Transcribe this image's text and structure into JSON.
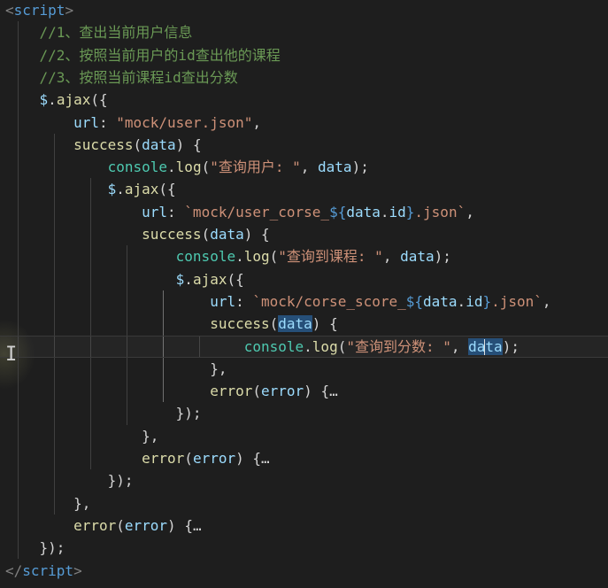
{
  "editor": {
    "lines": [
      {
        "segments": [
          {
            "t": "<",
            "c": "tag"
          },
          {
            "t": "script",
            "c": "kw"
          },
          {
            "t": ">",
            "c": "tag"
          }
        ]
      },
      {
        "segments": [
          {
            "t": "    //1、查出当前用户信息",
            "c": "cm"
          }
        ]
      },
      {
        "segments": [
          {
            "t": "    //2、按照当前用户的id查出他的课程",
            "c": "cm"
          }
        ]
      },
      {
        "segments": [
          {
            "t": "    //3、按照当前课程id查出分数",
            "c": "cm"
          }
        ]
      },
      {
        "segments": [
          {
            "t": "    ",
            "c": "pun"
          },
          {
            "t": "$",
            "c": "var"
          },
          {
            "t": ".",
            "c": "pun"
          },
          {
            "t": "ajax",
            "c": "fn"
          },
          {
            "t": "({",
            "c": "pun"
          }
        ]
      },
      {
        "segments": [
          {
            "t": "        ",
            "c": "pun"
          },
          {
            "t": "url",
            "c": "prop"
          },
          {
            "t": ": ",
            "c": "pun"
          },
          {
            "t": "\"mock/user.json\"",
            "c": "str"
          },
          {
            "t": ",",
            "c": "pun"
          }
        ]
      },
      {
        "segments": [
          {
            "t": "        ",
            "c": "pun"
          },
          {
            "t": "success",
            "c": "fn"
          },
          {
            "t": "(",
            "c": "pun"
          },
          {
            "t": "data",
            "c": "var"
          },
          {
            "t": ") {",
            "c": "pun"
          }
        ]
      },
      {
        "segments": [
          {
            "t": "            ",
            "c": "pun"
          },
          {
            "t": "console",
            "c": "cls"
          },
          {
            "t": ".",
            "c": "pun"
          },
          {
            "t": "log",
            "c": "fn"
          },
          {
            "t": "(",
            "c": "pun"
          },
          {
            "t": "\"查询用户: \"",
            "c": "str"
          },
          {
            "t": ", ",
            "c": "pun"
          },
          {
            "t": "data",
            "c": "var"
          },
          {
            "t": ");",
            "c": "pun"
          }
        ]
      },
      {
        "segments": [
          {
            "t": "            ",
            "c": "pun"
          },
          {
            "t": "$",
            "c": "var"
          },
          {
            "t": ".",
            "c": "pun"
          },
          {
            "t": "ajax",
            "c": "fn"
          },
          {
            "t": "({",
            "c": "pun"
          }
        ]
      },
      {
        "segments": [
          {
            "t": "                ",
            "c": "pun"
          },
          {
            "t": "url",
            "c": "prop"
          },
          {
            "t": ": ",
            "c": "pun"
          },
          {
            "t": "`mock/user_corse_",
            "c": "str"
          },
          {
            "t": "${",
            "c": "tpl"
          },
          {
            "t": "data",
            "c": "var"
          },
          {
            "t": ".",
            "c": "pun"
          },
          {
            "t": "id",
            "c": "prop"
          },
          {
            "t": "}",
            "c": "tpl"
          },
          {
            "t": ".json`",
            "c": "str"
          },
          {
            "t": ",",
            "c": "pun"
          }
        ]
      },
      {
        "segments": [
          {
            "t": "                ",
            "c": "pun"
          },
          {
            "t": "success",
            "c": "fn"
          },
          {
            "t": "(",
            "c": "pun"
          },
          {
            "t": "data",
            "c": "var"
          },
          {
            "t": ") {",
            "c": "pun"
          }
        ]
      },
      {
        "segments": [
          {
            "t": "                    ",
            "c": "pun"
          },
          {
            "t": "console",
            "c": "cls"
          },
          {
            "t": ".",
            "c": "pun"
          },
          {
            "t": "log",
            "c": "fn"
          },
          {
            "t": "(",
            "c": "pun"
          },
          {
            "t": "\"查询到课程: \"",
            "c": "str"
          },
          {
            "t": ", ",
            "c": "pun"
          },
          {
            "t": "data",
            "c": "var"
          },
          {
            "t": ");",
            "c": "pun"
          }
        ]
      },
      {
        "segments": [
          {
            "t": "                    ",
            "c": "pun"
          },
          {
            "t": "$",
            "c": "var"
          },
          {
            "t": ".",
            "c": "pun"
          },
          {
            "t": "ajax",
            "c": "fn"
          },
          {
            "t": "({",
            "c": "pun"
          }
        ]
      },
      {
        "segments": [
          {
            "t": "                        ",
            "c": "pun"
          },
          {
            "t": "url",
            "c": "prop"
          },
          {
            "t": ": ",
            "c": "pun"
          },
          {
            "t": "`mock/corse_score_",
            "c": "str"
          },
          {
            "t": "${",
            "c": "tpl"
          },
          {
            "t": "data",
            "c": "var"
          },
          {
            "t": ".",
            "c": "pun"
          },
          {
            "t": "id",
            "c": "prop"
          },
          {
            "t": "}",
            "c": "tpl"
          },
          {
            "t": ".json`",
            "c": "str"
          },
          {
            "t": ",",
            "c": "pun"
          }
        ]
      },
      {
        "segments": [
          {
            "t": "                        ",
            "c": "pun"
          },
          {
            "t": "success",
            "c": "fn"
          },
          {
            "t": "(",
            "c": "pun"
          },
          {
            "t": "data",
            "c": "var hl"
          },
          {
            "t": ") {",
            "c": "pun"
          }
        ]
      },
      {
        "current": true,
        "segments": [
          {
            "t": "                            ",
            "c": "pun"
          },
          {
            "t": "console",
            "c": "cls"
          },
          {
            "t": ".",
            "c": "pun"
          },
          {
            "t": "log",
            "c": "fn"
          },
          {
            "t": "(",
            "c": "pun"
          },
          {
            "t": "\"查询到分数: \"",
            "c": "str"
          },
          {
            "t": ", ",
            "c": "pun"
          },
          {
            "t": "da",
            "c": "var hl2"
          },
          {
            "caret": true
          },
          {
            "t": "ta",
            "c": "var hl2"
          },
          {
            "t": ");",
            "c": "pun"
          }
        ]
      },
      {
        "segments": [
          {
            "t": "                        },",
            "c": "pun"
          }
        ]
      },
      {
        "segments": [
          {
            "t": "                        ",
            "c": "pun"
          },
          {
            "t": "error",
            "c": "fn"
          },
          {
            "t": "(",
            "c": "pun"
          },
          {
            "t": "error",
            "c": "var"
          },
          {
            "t": ") {",
            "c": "pun"
          },
          {
            "t": "…",
            "c": "ell"
          }
        ]
      },
      {
        "segments": [
          {
            "t": "                    });",
            "c": "pun"
          }
        ]
      },
      {
        "segments": [
          {
            "t": "                },",
            "c": "pun"
          }
        ]
      },
      {
        "segments": [
          {
            "t": "                ",
            "c": "pun"
          },
          {
            "t": "error",
            "c": "fn"
          },
          {
            "t": "(",
            "c": "pun"
          },
          {
            "t": "error",
            "c": "var"
          },
          {
            "t": ") {",
            "c": "pun"
          },
          {
            "t": "…",
            "c": "ell"
          }
        ]
      },
      {
        "segments": [
          {
            "t": "            });",
            "c": "pun"
          }
        ]
      },
      {
        "segments": [
          {
            "t": "        },",
            "c": "pun"
          }
        ]
      },
      {
        "segments": [
          {
            "t": "        ",
            "c": "pun"
          },
          {
            "t": "error",
            "c": "fn"
          },
          {
            "t": "(",
            "c": "pun"
          },
          {
            "t": "error",
            "c": "var"
          },
          {
            "t": ") {",
            "c": "pun"
          },
          {
            "t": "…",
            "c": "ell"
          }
        ]
      },
      {
        "segments": [
          {
            "t": "    });",
            "c": "pun"
          }
        ]
      },
      {
        "segments": [
          {
            "t": "</",
            "c": "tag"
          },
          {
            "t": "script",
            "c": "kw"
          },
          {
            "t": ">",
            "c": "tag"
          }
        ]
      }
    ]
  },
  "colors": {
    "background": "#1e1e1e",
    "comment": "#6a9955",
    "keyword": "#569cd6",
    "string": "#ce9178",
    "function": "#dcdcaa",
    "variable": "#9cdcfe",
    "class": "#4ec9b0",
    "selection": "#264f78"
  },
  "cursor_icon": "text-ibeam-icon"
}
